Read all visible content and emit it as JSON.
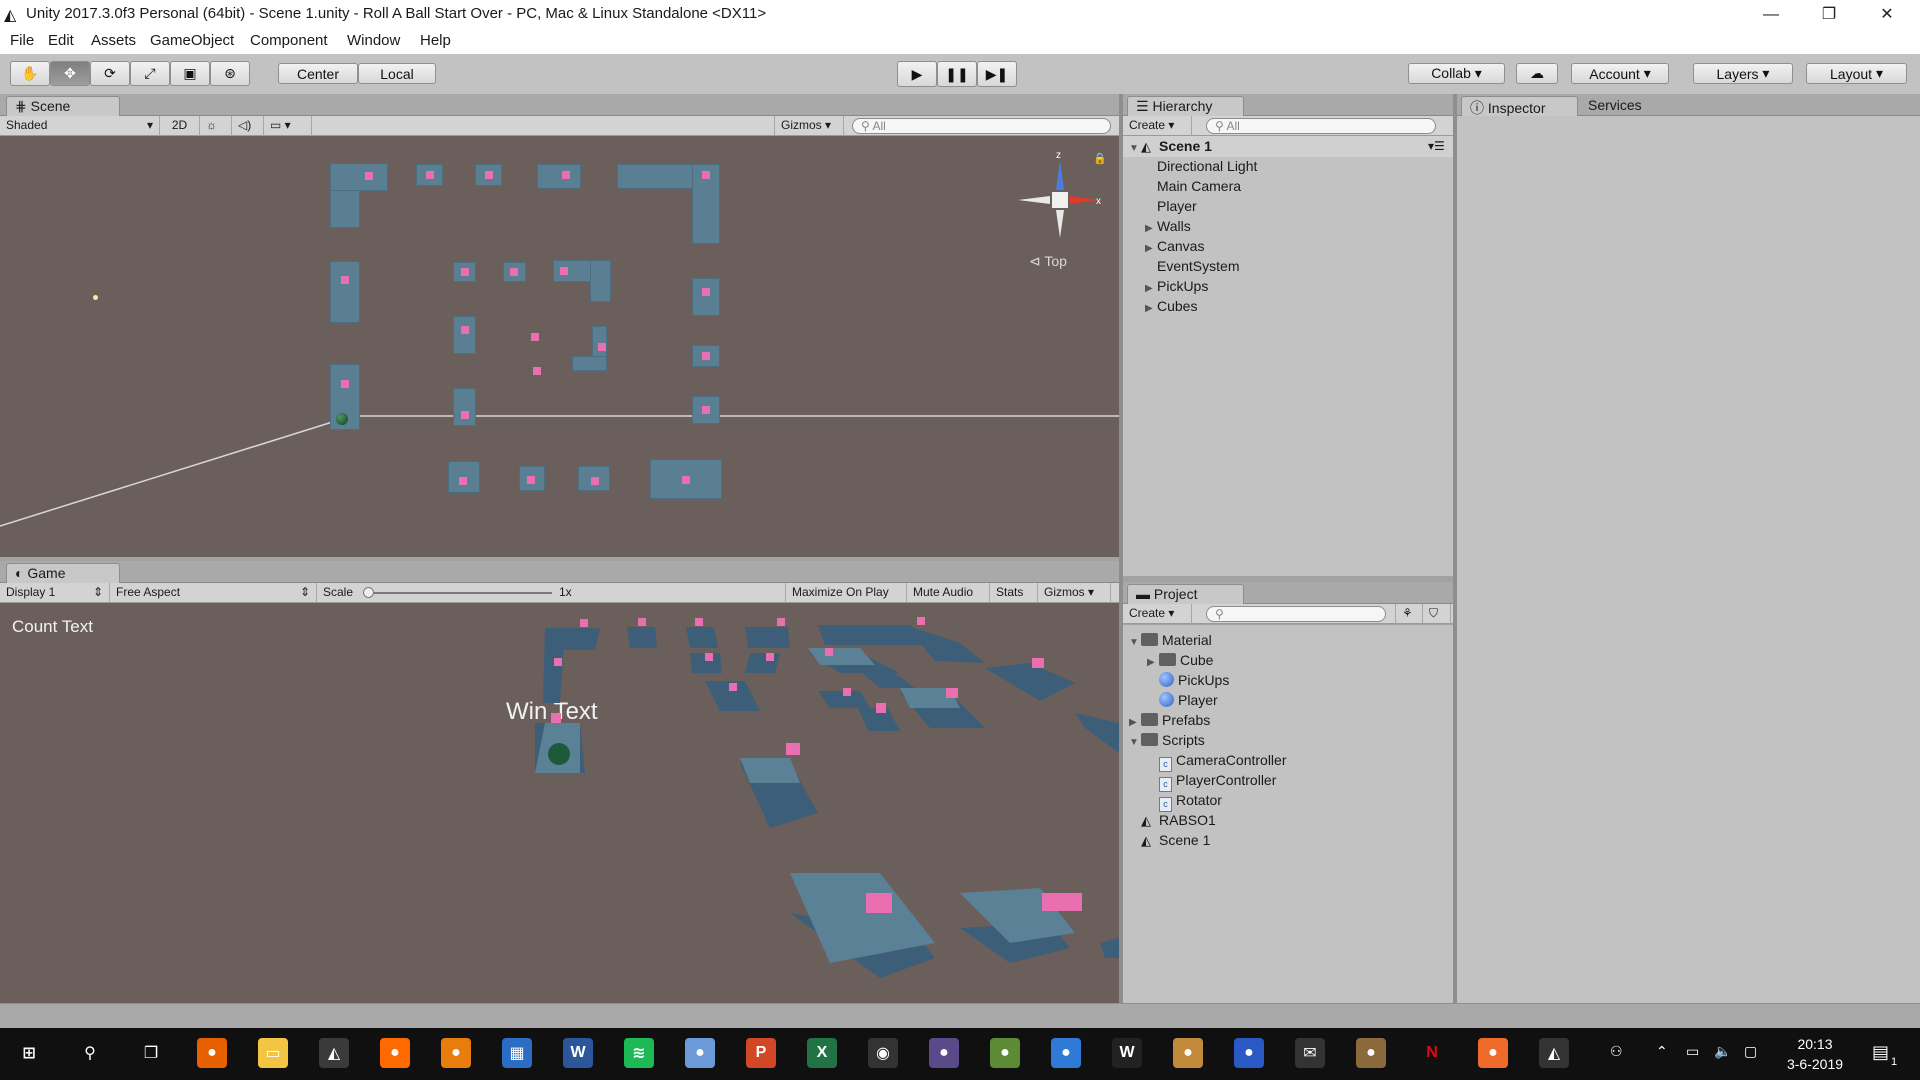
{
  "window": {
    "title": "Unity 2017.3.0f3 Personal (64bit) - Scene 1.unity - Roll A Ball Start Over - PC, Mac & Linux Standalone <DX11>",
    "minimize": "—",
    "restore": "❐",
    "close": "✕"
  },
  "menu": [
    "File",
    "Edit",
    "Assets",
    "GameObject",
    "Component",
    "Window",
    "Help"
  ],
  "toolbar": {
    "pivot_center": "Center",
    "pivot_local": "Local",
    "play_icons": [
      "▶",
      "❚❚",
      "▶❚"
    ],
    "collab": "Collab ▾",
    "account": "Account",
    "layers": "Layers",
    "layout": "Layout"
  },
  "scene": {
    "tab": "Scene",
    "shading": "Shaded",
    "mode_2d": "2D",
    "gizmos": "Gizmos",
    "search_placeholder": "All",
    "view_label": "Top"
  },
  "game": {
    "tab": "Game",
    "display": "Display 1",
    "aspect": "Free Aspect",
    "scale_label": "Scale",
    "scale_value": "1x",
    "scale_level": 0,
    "maximize": "Maximize On Play",
    "mute": "Mute Audio",
    "stats": "Stats",
    "gizmos": "Gizmos",
    "count_text": "Count Text",
    "win_text": "Win Text"
  },
  "hierarchy": {
    "tab": "Hierarchy",
    "create": "Create",
    "search_placeholder": "All",
    "scene": "Scene 1",
    "items": [
      {
        "label": "Directional Light",
        "expandable": false
      },
      {
        "label": "Main Camera",
        "expandable": false
      },
      {
        "label": "Player",
        "expandable": false
      },
      {
        "label": "Walls",
        "expandable": true
      },
      {
        "label": "Canvas",
        "expandable": true
      },
      {
        "label": "EventSystem",
        "expandable": false
      },
      {
        "label": "PickUps",
        "expandable": true
      },
      {
        "label": "Cubes",
        "expandable": true
      }
    ]
  },
  "inspector": {
    "tab": "Inspector",
    "services_tab": "Services"
  },
  "project": {
    "tab": "Project",
    "create": "Create",
    "items": [
      {
        "label": "Material",
        "type": "folder",
        "depth": 0,
        "state": "open"
      },
      {
        "label": "Cube",
        "type": "folder",
        "depth": 1,
        "state": "closed"
      },
      {
        "label": "PickUps",
        "type": "material",
        "depth": 1,
        "state": "none"
      },
      {
        "label": "Player",
        "type": "material",
        "depth": 1,
        "state": "none"
      },
      {
        "label": "Prefabs",
        "type": "folder",
        "depth": 0,
        "state": "closed"
      },
      {
        "label": "Scripts",
        "type": "folder",
        "depth": 0,
        "state": "open"
      },
      {
        "label": "CameraController",
        "type": "script",
        "depth": 1,
        "state": "none"
      },
      {
        "label": "PlayerController",
        "type": "script",
        "depth": 1,
        "state": "none"
      },
      {
        "label": "Rotator",
        "type": "script",
        "depth": 1,
        "state": "none"
      },
      {
        "label": "RABSO1",
        "type": "scene",
        "depth": 0,
        "state": "none"
      },
      {
        "label": "Scene 1",
        "type": "scene",
        "depth": 0,
        "state": "none"
      }
    ]
  },
  "taskbar": {
    "apps": [
      "start-icon",
      "search-icon",
      "task-view-icon",
      "firefox-icon",
      "file-explorer-icon",
      "unity-icon",
      "houdini-icon",
      "blender-icon",
      "store-icon",
      "word-icon",
      "spotify-icon",
      "paint-icon",
      "powerpoint-icon",
      "excel-icon",
      "camera-icon",
      "game-icon",
      "minecraft-icon",
      "remote-desktop-icon",
      "wattpad-icon",
      "app-icon",
      "sonic-icon",
      "mail-icon",
      "tools-icon",
      "netflix-icon",
      "brave-icon",
      "unity-hub-icon"
    ],
    "time": "20:13",
    "date": "3-6-2019",
    "notifications": "1"
  }
}
